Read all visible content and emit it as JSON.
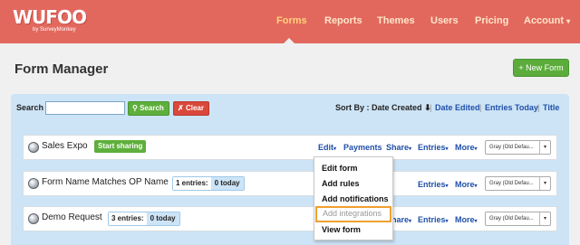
{
  "header": {
    "logo_main": "WUFOO",
    "logo_sub": "by SurveyMonkey",
    "nav": [
      "Forms",
      "Reports",
      "Themes",
      "Users",
      "Pricing",
      "Account"
    ],
    "account_caret": "▾"
  },
  "page": {
    "title": "Form Manager",
    "new_form": "+ New Form"
  },
  "toolbar": {
    "search_label": "Search",
    "search_value": "",
    "search_button": "Search",
    "clear_button": "Clear",
    "sort_by": "Sort By :",
    "sort_date_created": "Date Created",
    "sort_arrow": "⬇",
    "sort_date_edited": "Date Edited",
    "sort_entries_today": "Entries Today",
    "sort_title": "Title",
    "sep": "|"
  },
  "rows": [
    {
      "name": "Sales Expo",
      "badge": "Start sharing"
    },
    {
      "name": "Form Name Matches OP Name",
      "entries": "1 entries:",
      "today": "0 today"
    },
    {
      "name": "Demo Request",
      "entries": "3 entries:",
      "today": "0 today"
    }
  ],
  "actions": {
    "edit": "Edit",
    "payments": "Payments",
    "share": "Share",
    "entries": "Entries",
    "more": "More",
    "caret": "▾"
  },
  "theme_select": "Gray (Old Defau...",
  "edit_menu": [
    "Edit form",
    "Add rules",
    "Add notifications",
    "Add integrations",
    "View form"
  ],
  "colors": {
    "header": "#e2685e",
    "panel": "#cde4f6",
    "green": "#5eaf3c",
    "red": "#d9483b",
    "link": "#1f4fa8",
    "highlight": "#f0a030"
  }
}
